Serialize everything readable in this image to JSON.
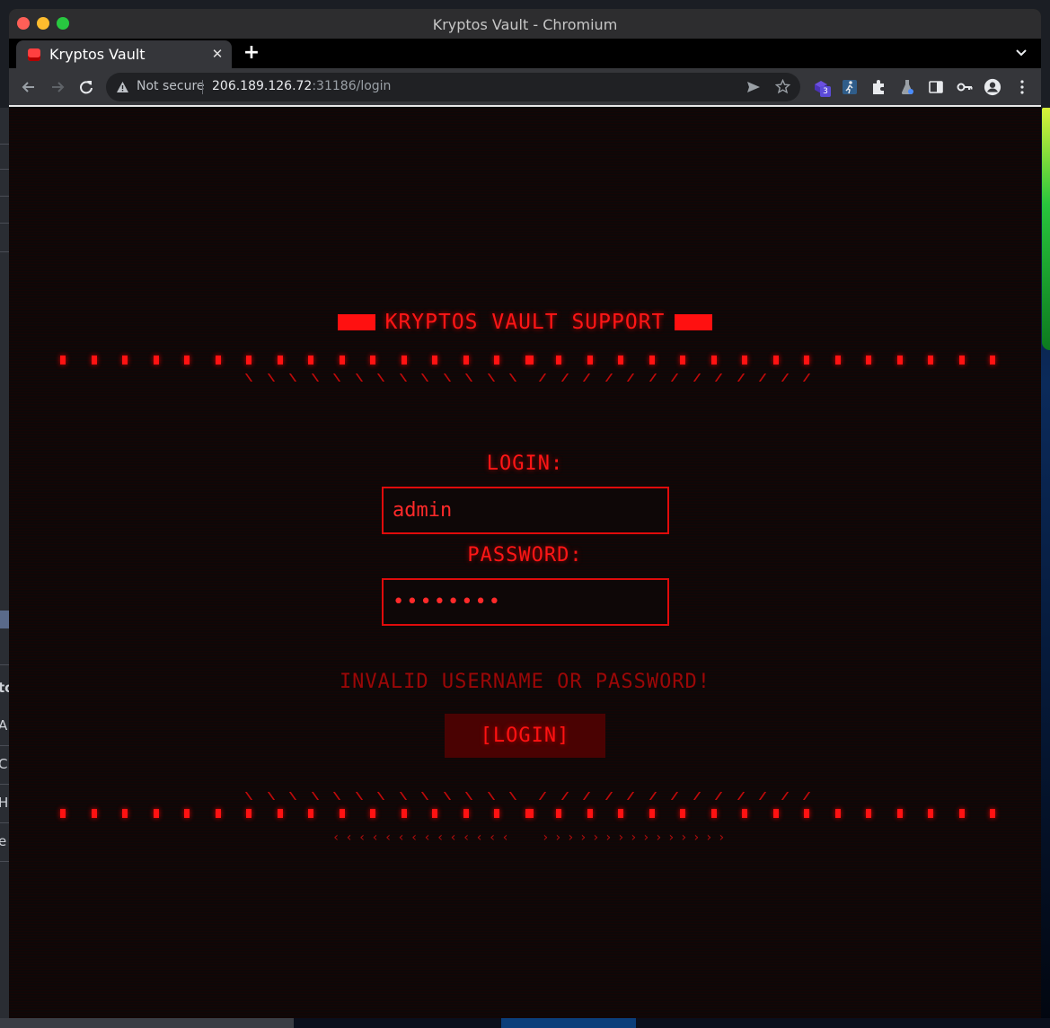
{
  "window": {
    "title": "Kryptos Vault - Chromium"
  },
  "tab": {
    "title": "Kryptos Vault"
  },
  "address_bar": {
    "security_label": "Not secure",
    "url_host": "206.189.126.72",
    "url_rest": ":31186/login"
  },
  "extensions": {
    "badge_count": "3"
  },
  "page": {
    "heading": "KRYPTOS VAULT SUPPORT",
    "login_label": "LOGIN:",
    "username_value": "admin",
    "password_label": "PASSWORD:",
    "password_value": "••••••••",
    "error_message": "INVALID USERNAME OR PASSWORD!",
    "login_button": "[LOGIN]"
  },
  "desktop": {
    "left_letters": [
      "to",
      "A",
      "C",
      "H",
      "e"
    ]
  },
  "colors": {
    "accent": "#ff1616",
    "error": "#9c0707",
    "button_bg": "#4a0202",
    "page_bg": "#0d0808"
  }
}
